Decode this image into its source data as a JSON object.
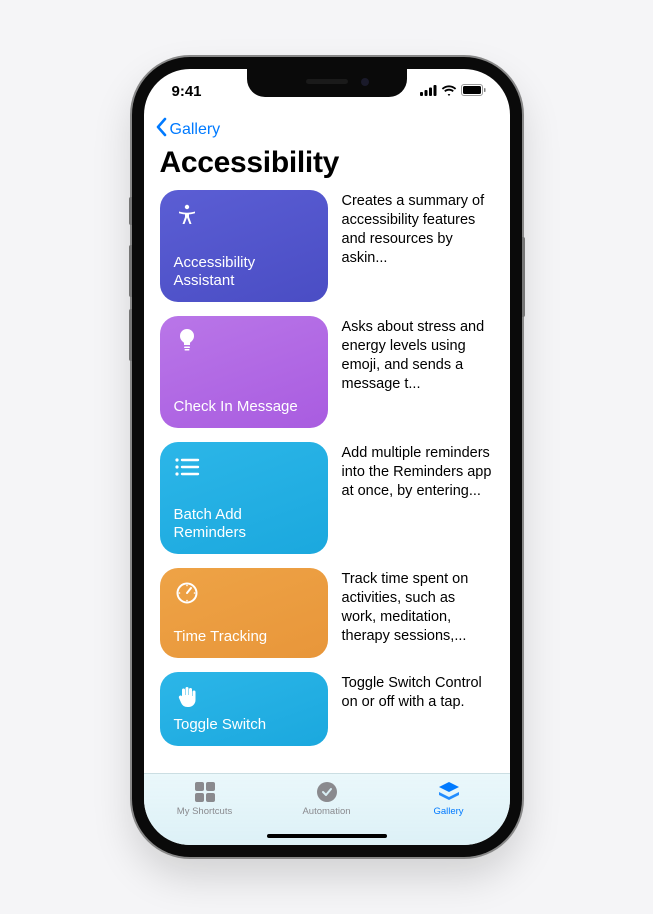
{
  "status": {
    "time": "9:41"
  },
  "nav": {
    "back_label": "Gallery"
  },
  "page": {
    "title": "Accessibility"
  },
  "shortcuts": [
    {
      "title": "Accessibility Assistant",
      "desc": "Creates a summary of accessibility features and resources by askin...",
      "icon": "accessibility-figure-icon"
    },
    {
      "title": "Check In Message",
      "desc": "Asks about stress and energy levels using emoji, and sends a message t...",
      "icon": "lightbulb-icon"
    },
    {
      "title": "Batch Add Reminders",
      "desc": "Add multiple reminders into the Reminders app at once, by entering...",
      "icon": "list-bullet-icon"
    },
    {
      "title": "Time Tracking",
      "desc": "Track time spent on activities, such as work, meditation, therapy sessions,...",
      "icon": "gauge-icon"
    },
    {
      "title": "Toggle Switch",
      "desc": "Toggle Switch Control on or off with a tap.",
      "icon": "hand-raised-icon"
    }
  ],
  "tabs": [
    {
      "label": "My Shortcuts",
      "icon": "grid-icon",
      "active": false
    },
    {
      "label": "Automation",
      "icon": "checkmark-seal-icon",
      "active": false
    },
    {
      "label": "Gallery",
      "icon": "stack-icon",
      "active": true
    }
  ]
}
